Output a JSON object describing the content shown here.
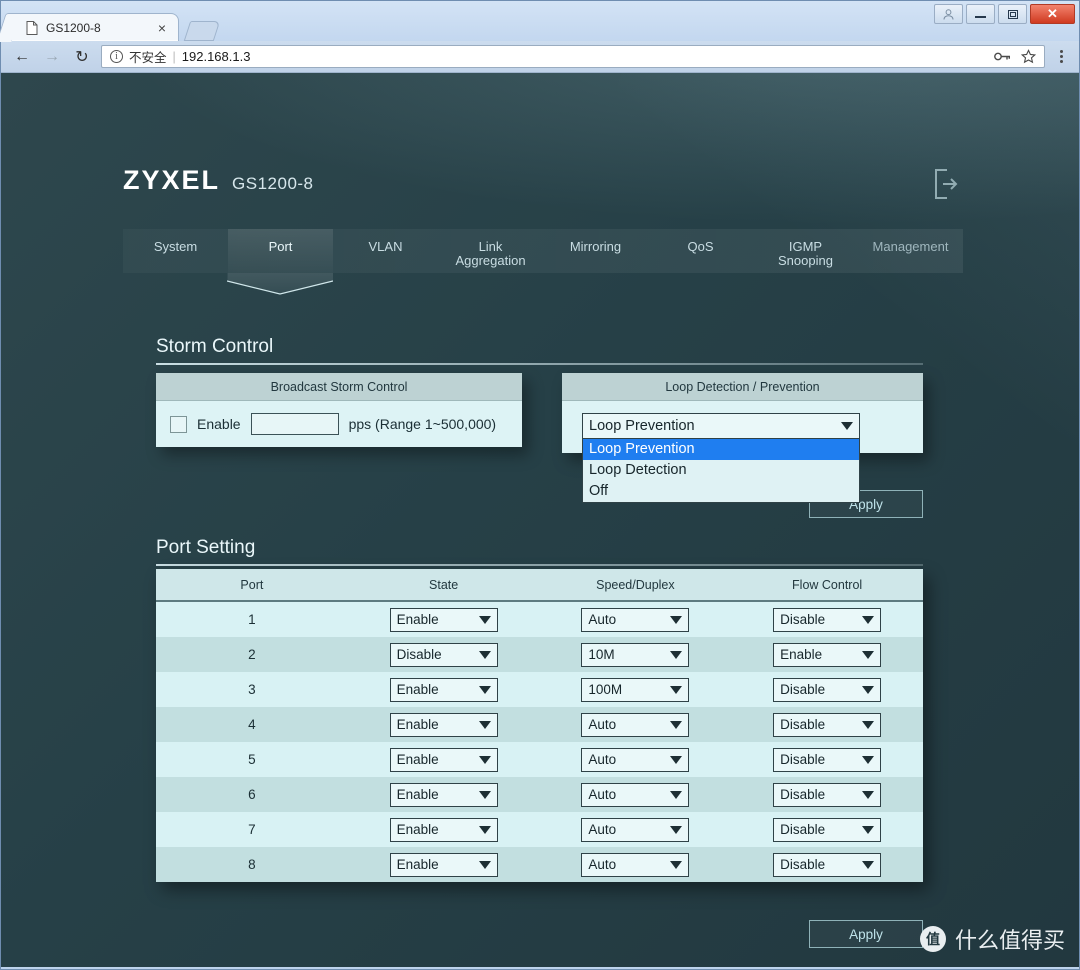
{
  "browser": {
    "tab": {
      "title": "GS1200-8",
      "favicon": "page-icon",
      "close_label": "×"
    },
    "new_tab_label": "",
    "window_controls": {
      "user": "○",
      "minimize": "minimize-icon",
      "maximize": "maximize-icon",
      "close": "✕"
    },
    "toolbar": {
      "back": "←",
      "forward": "→",
      "reload": "↻",
      "security_text": "不安全",
      "separator": "|",
      "url": "192.168.1.3",
      "password_icon": "key-icon",
      "bookmark_icon": "star-icon",
      "menu_icon": "kebab-menu-icon"
    }
  },
  "device": {
    "brand": "ZYXEL",
    "model": "GS1200-8",
    "logout_icon": "logout-icon",
    "nav": [
      {
        "label": "System",
        "active": false,
        "dim": false
      },
      {
        "label": "Port",
        "active": true,
        "dim": false
      },
      {
        "label": "VLAN",
        "active": false,
        "dim": false
      },
      {
        "label": "Link\nAggregation",
        "line1": "Link",
        "line2": "Aggregation",
        "active": false,
        "dim": false
      },
      {
        "label": "Mirroring",
        "active": false,
        "dim": false
      },
      {
        "label": "QoS",
        "active": false,
        "dim": false
      },
      {
        "label": "IGMP\nSnooping",
        "line1": "IGMP",
        "line2": "Snooping",
        "active": false,
        "dim": false
      },
      {
        "label": "Management",
        "active": false,
        "dim": true
      }
    ],
    "storm_control": {
      "title": "Storm Control",
      "broadcast": {
        "header": "Broadcast Storm Control",
        "enable_label": "Enable",
        "checked": false,
        "pps_value": "",
        "pps_placeholder": "",
        "units_text": "pps (Range 1~500,000)"
      },
      "loop": {
        "header": "Loop Detection / Prevention",
        "selected": "Loop Prevention",
        "open": true,
        "options": [
          "Loop Prevention",
          "Loop Detection",
          "Off"
        ],
        "highlighted_index": 0
      },
      "apply_label": "Apply"
    },
    "port_setting": {
      "title": "Port Setting",
      "columns": [
        "Port",
        "State",
        "Speed/Duplex",
        "Flow Control"
      ],
      "rows": [
        {
          "port": "1",
          "state": "Enable",
          "speed": "Auto",
          "flow": "Disable"
        },
        {
          "port": "2",
          "state": "Disable",
          "speed": "10M",
          "flow": "Enable"
        },
        {
          "port": "3",
          "state": "Enable",
          "speed": "100M",
          "flow": "Disable"
        },
        {
          "port": "4",
          "state": "Enable",
          "speed": "Auto",
          "flow": "Disable"
        },
        {
          "port": "5",
          "state": "Enable",
          "speed": "Auto",
          "flow": "Disable"
        },
        {
          "port": "6",
          "state": "Enable",
          "speed": "Auto",
          "flow": "Disable"
        },
        {
          "port": "7",
          "state": "Enable",
          "speed": "Auto",
          "flow": "Disable"
        },
        {
          "port": "8",
          "state": "Enable",
          "speed": "Auto",
          "flow": "Disable"
        }
      ],
      "apply_label": "Apply"
    },
    "watermark": {
      "badge": "值",
      "text": "什么值得买"
    }
  },
  "colors": {
    "page_background": "#264047",
    "panel_background": "#ddf3f5",
    "panel_header": "#bdd2d3",
    "row_odd": "#d8f2f4",
    "row_even": "#c2dfe0",
    "highlight_blue": "#1f7ef0",
    "accent_text": "#bfe3ea",
    "close_button": "#d03a20"
  }
}
